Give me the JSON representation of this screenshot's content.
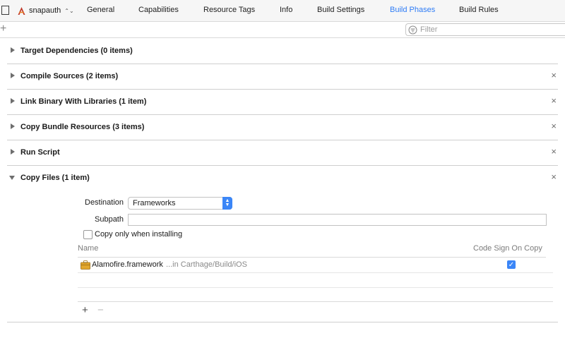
{
  "toolbar": {
    "target_name": "snapauth",
    "tabs": [
      {
        "label": "General"
      },
      {
        "label": "Capabilities"
      },
      {
        "label": "Resource Tags"
      },
      {
        "label": "Info"
      },
      {
        "label": "Build Settings"
      },
      {
        "label": "Build Phases"
      },
      {
        "label": "Build Rules"
      }
    ],
    "active_tab": "Build Phases",
    "active_color": "#2e7cf6"
  },
  "filter": {
    "add_label": "+",
    "placeholder": "Filter"
  },
  "phases": [
    {
      "title": "Target Dependencies (0 items)",
      "expanded": false,
      "removable": false
    },
    {
      "title": "Compile Sources (2 items)",
      "expanded": false,
      "removable": true
    },
    {
      "title": "Link Binary With Libraries (1 item)",
      "expanded": false,
      "removable": true
    },
    {
      "title": "Copy Bundle Resources (3 items)",
      "expanded": false,
      "removable": true
    },
    {
      "title": "Run Script",
      "expanded": false,
      "removable": true
    },
    {
      "title": "Copy Files (1 item)",
      "expanded": true,
      "removable": true
    }
  ],
  "copy_files": {
    "destination_label": "Destination",
    "destination_value": "Frameworks",
    "subpath_label": "Subpath",
    "subpath_value": "",
    "copy_only_label": "Copy only when installing",
    "copy_only_checked": false,
    "columns": {
      "name": "Name",
      "code_sign": "Code Sign On Copy"
    },
    "files": [
      {
        "name": "Alamofire.framework",
        "path": "...in Carthage/Build/iOS",
        "code_sign": true
      }
    ],
    "add_label": "+",
    "remove_label": "−"
  },
  "icons": {
    "close": "×",
    "checkmark": "✓",
    "popup_arrows": "▲▼",
    "stepper": "⌃⌄"
  }
}
